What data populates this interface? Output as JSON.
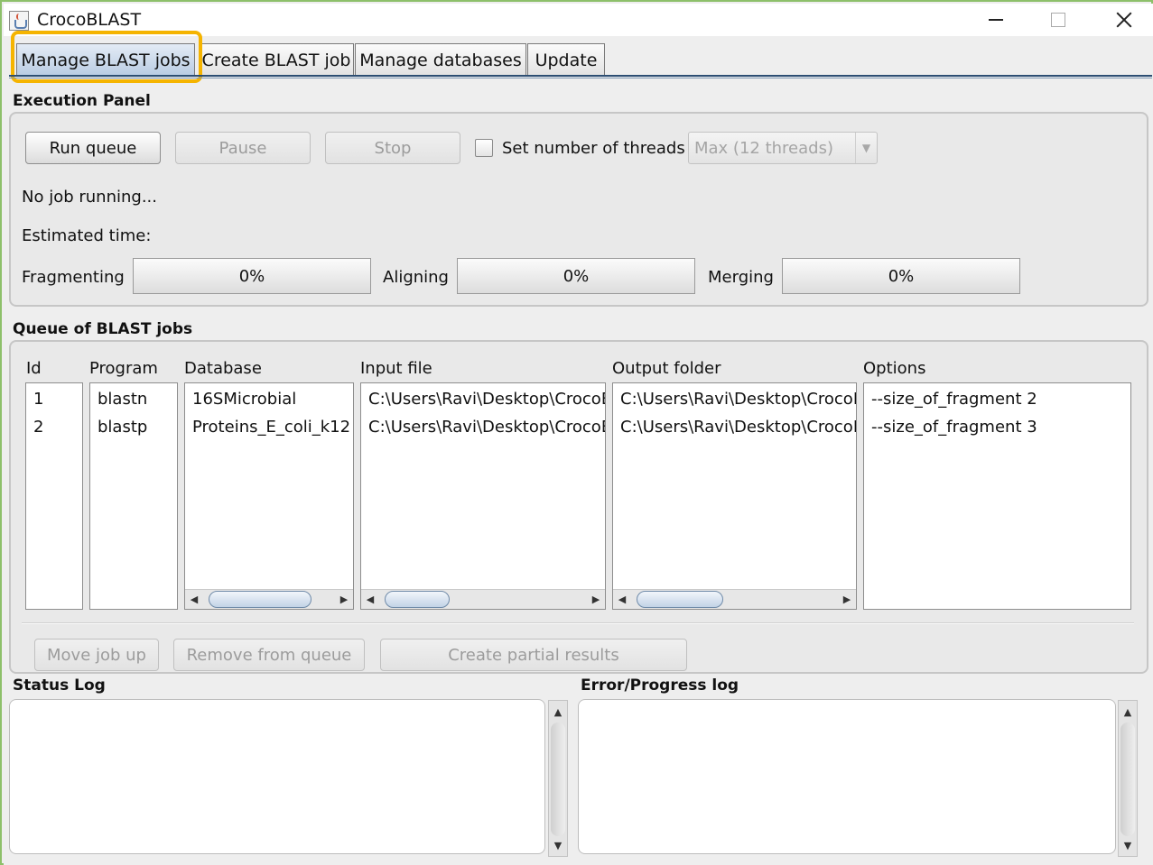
{
  "window": {
    "title": "CrocoBLAST",
    "minimize_glyph": "",
    "maximize_glyph": "",
    "close_glyph": ""
  },
  "tabs": [
    {
      "label": "Manage BLAST jobs",
      "active": true
    },
    {
      "label": "Create BLAST job",
      "active": false
    },
    {
      "label": "Manage databases",
      "active": false
    },
    {
      "label": "Update",
      "active": false
    }
  ],
  "execution": {
    "title": "Execution Panel",
    "run_label": "Run queue",
    "pause_label": "Pause",
    "stop_label": "Stop",
    "threads_label": "Set number of threads",
    "threads_checked": false,
    "threads_value": "Max (12 threads)",
    "status_text": "No job running...",
    "estimated_label": "Estimated time:",
    "fragmenting_label": "Fragmenting",
    "fragmenting_value": "0%",
    "aligning_label": "Aligning",
    "aligning_value": "0%",
    "merging_label": "Merging",
    "merging_value": "0%"
  },
  "queue": {
    "title": "Queue of BLAST jobs",
    "columns": {
      "id": "Id",
      "program": "Program",
      "database": "Database",
      "input": "Input file",
      "output": "Output folder",
      "options": "Options"
    },
    "rows": [
      {
        "id": "1",
        "program": "blastn",
        "database": "16SMicrobial",
        "input": "C:\\Users\\Ravi\\Desktop\\CrocoB",
        "output": "C:\\Users\\Ravi\\Desktop\\CrocoB",
        "options": "--size_of_fragment 2"
      },
      {
        "id": "2",
        "program": "blastp",
        "database": "Proteins_E_coli_k12",
        "input": "C:\\Users\\Ravi\\Desktop\\CrocoB",
        "output": "C:\\Users\\Ravi\\Desktop\\CrocoB",
        "options": "--size_of_fragment 3"
      }
    ],
    "move_up_label": "Move job up",
    "remove_label": "Remove from queue",
    "partial_label": "Create partial results"
  },
  "logs": {
    "status_title": "Status Log",
    "error_title": "Error/Progress log"
  },
  "colors": {
    "tab_highlight": "#f5b400",
    "frame_border": "#8dc06a"
  }
}
